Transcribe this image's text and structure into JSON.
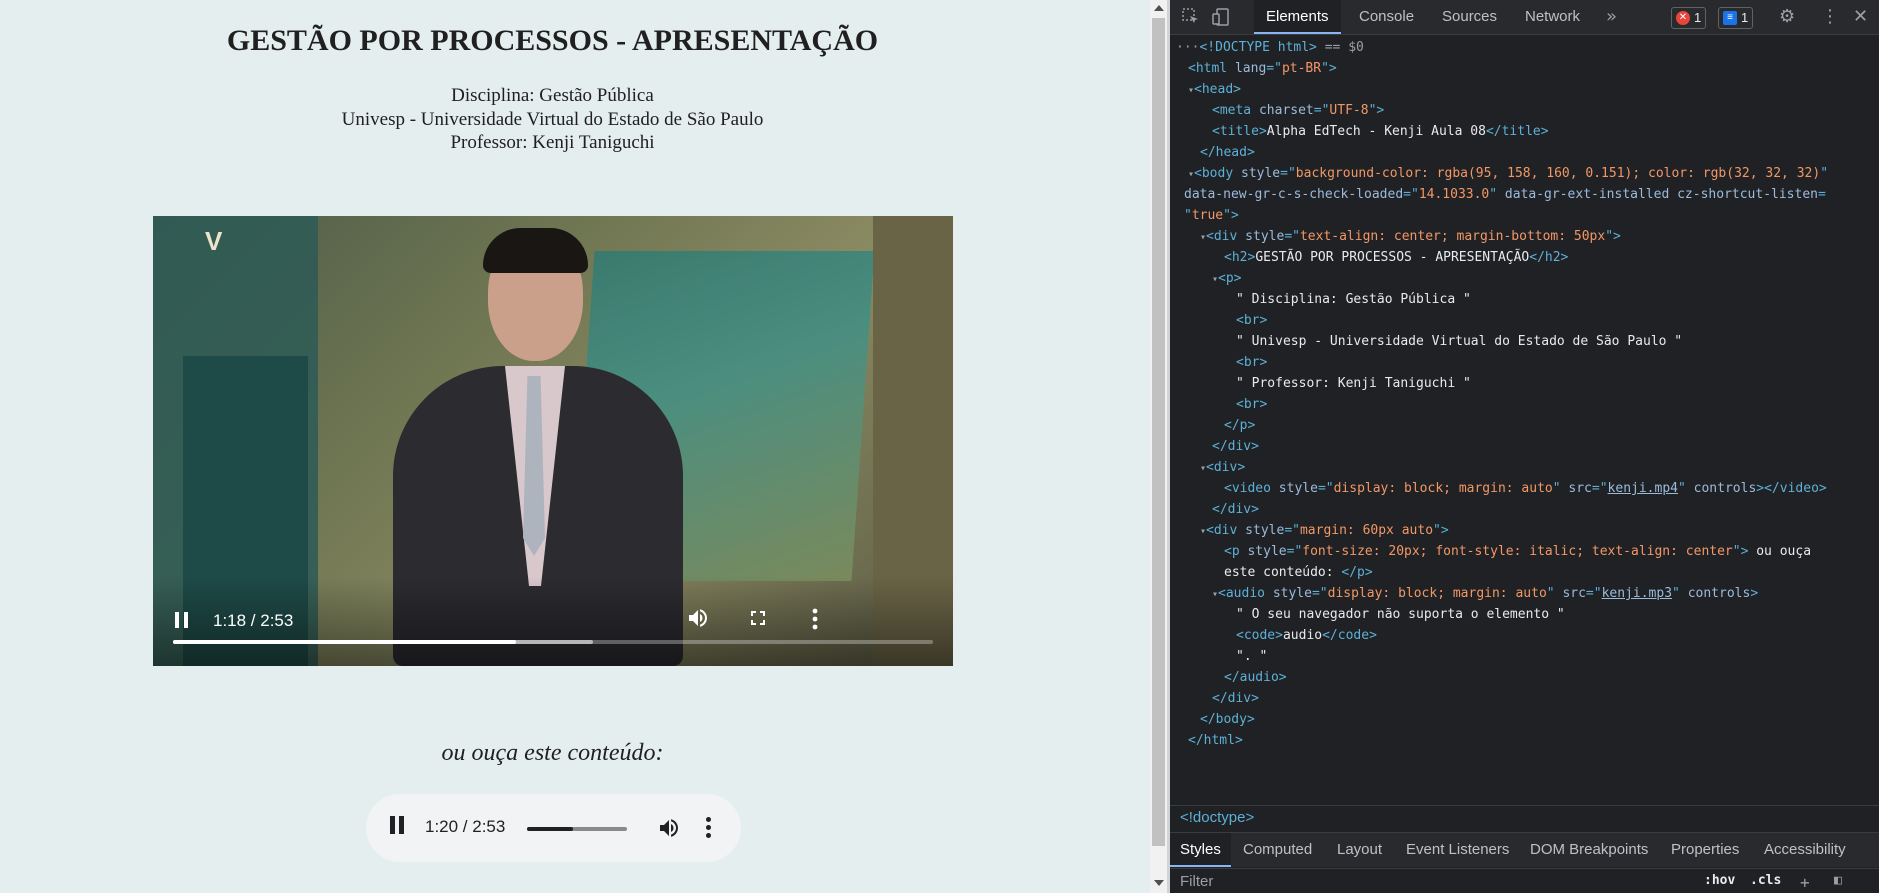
{
  "page": {
    "title": "GESTÃO POR PROCESSOS - APRESENTAÇÃO",
    "discipline": "Disciplina: Gestão Pública",
    "university": "Univesp - Universidade Virtual do Estado de São Paulo",
    "professor": "Professor: Kenji Taniguchi",
    "audio_caption": "ou ouça este conteúdo:"
  },
  "video": {
    "time": "1:18 / 2:53",
    "progress_fraction": 0.451,
    "buffered_fraction": 0.553,
    "watermark": "V"
  },
  "audio": {
    "time": "1:20 / 2:53",
    "progress_fraction": 0.462
  },
  "devtools": {
    "tabs": [
      "Elements",
      "Console",
      "Sources",
      "Network"
    ],
    "more_tabs": "»",
    "error_count": "1",
    "message_count": "1",
    "dom_lines": [
      {
        "indent": 0,
        "tri": "",
        "parts": [
          {
            "c": "cmt",
            "t": "···"
          },
          {
            "c": "tag",
            "t": "<!DOCTYPE html>"
          },
          {
            "c": "cmt",
            "t": " == "
          },
          {
            "c": "cmt",
            "t": "$0"
          }
        ]
      },
      {
        "indent": 1,
        "tri": "",
        "parts": [
          {
            "c": "tag",
            "t": "<html "
          },
          {
            "c": "attr",
            "t": "lang"
          },
          {
            "c": "tag",
            "t": "=\""
          },
          {
            "c": "val",
            "t": "pt-BR"
          },
          {
            "c": "tag",
            "t": "\">"
          }
        ]
      },
      {
        "indent": 1,
        "tri": "▾",
        "parts": [
          {
            "c": "tag",
            "t": "<head>"
          }
        ]
      },
      {
        "indent": 3,
        "tri": "",
        "parts": [
          {
            "c": "tag",
            "t": "<meta "
          },
          {
            "c": "attr",
            "t": "charset"
          },
          {
            "c": "tag",
            "t": "=\""
          },
          {
            "c": "val",
            "t": "UTF-8"
          },
          {
            "c": "tag",
            "t": "\">"
          }
        ]
      },
      {
        "indent": 3,
        "tri": "",
        "parts": [
          {
            "c": "tag",
            "t": "<title>"
          },
          {
            "c": "txt",
            "t": "Alpha EdTech - Kenji Aula 08"
          },
          {
            "c": "tag",
            "t": "</title>"
          }
        ]
      },
      {
        "indent": 2,
        "tri": "",
        "parts": [
          {
            "c": "tag",
            "t": "</head>"
          }
        ]
      },
      {
        "indent": 1,
        "tri": "▾",
        "parts": [
          {
            "c": "tag",
            "t": "<body "
          },
          {
            "c": "attr",
            "t": "style"
          },
          {
            "c": "tag",
            "t": "=\""
          },
          {
            "c": "val",
            "t": "background-color: rgba(95, 158, 160, 0.151); color: rgb(32, 32, 32)"
          },
          {
            "c": "tag",
            "t": "\""
          }
        ]
      },
      {
        "indent": 0,
        "tri": "",
        "parts": [
          {
            "c": "attr",
            "t": "data-new-gr-c-s-check-loaded"
          },
          {
            "c": "tag",
            "t": "=\""
          },
          {
            "c": "val",
            "t": "14.1033.0"
          },
          {
            "c": "tag",
            "t": "\" "
          },
          {
            "c": "attr",
            "t": "data-gr-ext-installed cz-shortcut-listen"
          },
          {
            "c": "tag",
            "t": "="
          }
        ]
      },
      {
        "indent": 0,
        "tri": "",
        "parts": [
          {
            "c": "tag",
            "t": "\""
          },
          {
            "c": "val",
            "t": "true"
          },
          {
            "c": "tag",
            "t": "\">"
          }
        ]
      },
      {
        "indent": 2,
        "tri": "▾",
        "parts": [
          {
            "c": "tag",
            "t": "<div "
          },
          {
            "c": "attr",
            "t": "style"
          },
          {
            "c": "tag",
            "t": "=\""
          },
          {
            "c": "val",
            "t": "text-align: center; margin-bottom: 50px"
          },
          {
            "c": "tag",
            "t": "\">"
          }
        ]
      },
      {
        "indent": 4,
        "tri": "",
        "parts": [
          {
            "c": "tag",
            "t": "<h2>"
          },
          {
            "c": "txt",
            "t": "GESTÃO POR PROCESSOS - APRESENTAÇÃO"
          },
          {
            "c": "tag",
            "t": "</h2>"
          }
        ]
      },
      {
        "indent": 3,
        "tri": "▾",
        "parts": [
          {
            "c": "tag",
            "t": "<p>"
          }
        ]
      },
      {
        "indent": 5,
        "tri": "",
        "parts": [
          {
            "c": "txt",
            "t": "\" Disciplina: Gestão Pública \""
          }
        ]
      },
      {
        "indent": 5,
        "tri": "",
        "parts": [
          {
            "c": "tag",
            "t": "<br>"
          }
        ]
      },
      {
        "indent": 5,
        "tri": "",
        "parts": [
          {
            "c": "txt",
            "t": "\" Univesp - Universidade Virtual do Estado de São Paulo \""
          }
        ]
      },
      {
        "indent": 5,
        "tri": "",
        "parts": [
          {
            "c": "tag",
            "t": "<br>"
          }
        ]
      },
      {
        "indent": 5,
        "tri": "",
        "parts": [
          {
            "c": "txt",
            "t": "\" Professor: Kenji Taniguchi \""
          }
        ]
      },
      {
        "indent": 5,
        "tri": "",
        "parts": [
          {
            "c": "tag",
            "t": "<br>"
          }
        ]
      },
      {
        "indent": 4,
        "tri": "",
        "parts": [
          {
            "c": "tag",
            "t": "</p>"
          }
        ]
      },
      {
        "indent": 3,
        "tri": "",
        "parts": [
          {
            "c": "tag",
            "t": "</div>"
          }
        ]
      },
      {
        "indent": 2,
        "tri": "▾",
        "parts": [
          {
            "c": "tag",
            "t": "<div>"
          }
        ]
      },
      {
        "indent": 4,
        "tri": "",
        "parts": [
          {
            "c": "tag",
            "t": "<video "
          },
          {
            "c": "attr",
            "t": "style"
          },
          {
            "c": "tag",
            "t": "=\""
          },
          {
            "c": "val",
            "t": "display: block; margin: auto"
          },
          {
            "c": "tag",
            "t": "\" "
          },
          {
            "c": "attr",
            "t": "src"
          },
          {
            "c": "tag",
            "t": "=\""
          },
          {
            "c": "link",
            "t": "kenji.mp4"
          },
          {
            "c": "tag",
            "t": "\" "
          },
          {
            "c": "attr",
            "t": "controls"
          },
          {
            "c": "tag",
            "t": "></video>"
          }
        ]
      },
      {
        "indent": 3,
        "tri": "",
        "parts": [
          {
            "c": "tag",
            "t": "</div>"
          }
        ]
      },
      {
        "indent": 2,
        "tri": "▾",
        "parts": [
          {
            "c": "tag",
            "t": "<div "
          },
          {
            "c": "attr",
            "t": "style"
          },
          {
            "c": "tag",
            "t": "=\""
          },
          {
            "c": "val",
            "t": "margin: 60px auto"
          },
          {
            "c": "tag",
            "t": "\">"
          }
        ]
      },
      {
        "indent": 4,
        "tri": "",
        "parts": [
          {
            "c": "tag",
            "t": "<p "
          },
          {
            "c": "attr",
            "t": "style"
          },
          {
            "c": "tag",
            "t": "=\""
          },
          {
            "c": "val",
            "t": "font-size: 20px; font-style: italic; text-align: center"
          },
          {
            "c": "tag",
            "t": "\">"
          },
          {
            "c": "txt",
            "t": " ou ouça"
          }
        ]
      },
      {
        "indent": 4,
        "tri": "",
        "parts": [
          {
            "c": "txt",
            "t": "este conteúdo: "
          },
          {
            "c": "tag",
            "t": "</p>"
          }
        ]
      },
      {
        "indent": 3,
        "tri": "▾",
        "parts": [
          {
            "c": "tag",
            "t": "<audio "
          },
          {
            "c": "attr",
            "t": "style"
          },
          {
            "c": "tag",
            "t": "=\""
          },
          {
            "c": "val",
            "t": "display: block; margin: auto"
          },
          {
            "c": "tag",
            "t": "\" "
          },
          {
            "c": "attr",
            "t": "src"
          },
          {
            "c": "tag",
            "t": "=\""
          },
          {
            "c": "link",
            "t": "kenji.mp3"
          },
          {
            "c": "tag",
            "t": "\" "
          },
          {
            "c": "attr",
            "t": "controls"
          },
          {
            "c": "tag",
            "t": ">"
          }
        ]
      },
      {
        "indent": 5,
        "tri": "",
        "parts": [
          {
            "c": "txt",
            "t": "\" O seu navegador não suporta o elemento \""
          }
        ]
      },
      {
        "indent": 5,
        "tri": "",
        "parts": [
          {
            "c": "tag",
            "t": "<code>"
          },
          {
            "c": "txt",
            "t": "audio"
          },
          {
            "c": "tag",
            "t": "</code>"
          }
        ]
      },
      {
        "indent": 5,
        "tri": "",
        "parts": [
          {
            "c": "txt",
            "t": "\". \""
          }
        ]
      },
      {
        "indent": 4,
        "tri": "",
        "parts": [
          {
            "c": "tag",
            "t": "</audio>"
          }
        ]
      },
      {
        "indent": 3,
        "tri": "",
        "parts": [
          {
            "c": "tag",
            "t": "</div>"
          }
        ]
      },
      {
        "indent": 2,
        "tri": "",
        "parts": [
          {
            "c": "tag",
            "t": "</body>"
          }
        ]
      },
      {
        "indent": 1,
        "tri": "",
        "parts": [
          {
            "c": "tag",
            "t": "</html>"
          }
        ]
      }
    ],
    "breadcrumb": "<!doctype>",
    "subtabs": [
      "Styles",
      "Computed",
      "Layout",
      "Event Listeners",
      "DOM Breakpoints",
      "Properties",
      "Accessibility"
    ],
    "filter_placeholder": "Filter",
    "filter_hov": ":hov",
    "filter_cls": ".cls",
    "filter_plus": "+"
  },
  "colors": {
    "page_bg": "#e4eeee",
    "devtools_bg": "#202124",
    "accent": "#8ab4f8",
    "error": "#e8453c",
    "message": "#1a73e8"
  }
}
